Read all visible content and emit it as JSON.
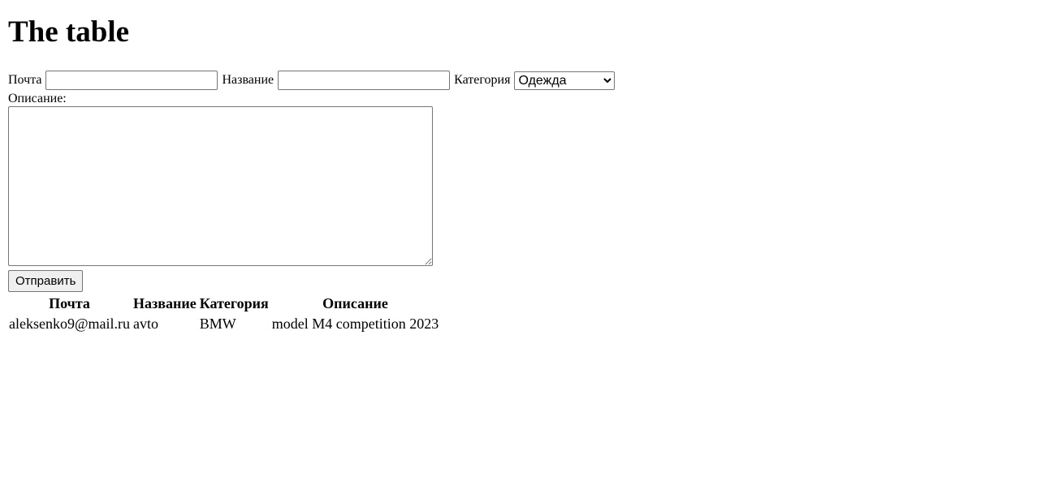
{
  "page": {
    "title": "The table"
  },
  "form": {
    "email_label": "Почта",
    "email_value": "",
    "name_label": "Название",
    "name_value": "",
    "category_label": "Категория",
    "category_selected": "Одежда",
    "description_label": "Описание:",
    "description_value": "",
    "submit_label": "Отправить"
  },
  "table": {
    "headers": [
      "Почта",
      "Название",
      "Категория",
      "Описание"
    ],
    "rows": [
      [
        "aleksenko9@mail.ru",
        "avto",
        "BMW",
        "model M4 competition 2023"
      ]
    ]
  }
}
